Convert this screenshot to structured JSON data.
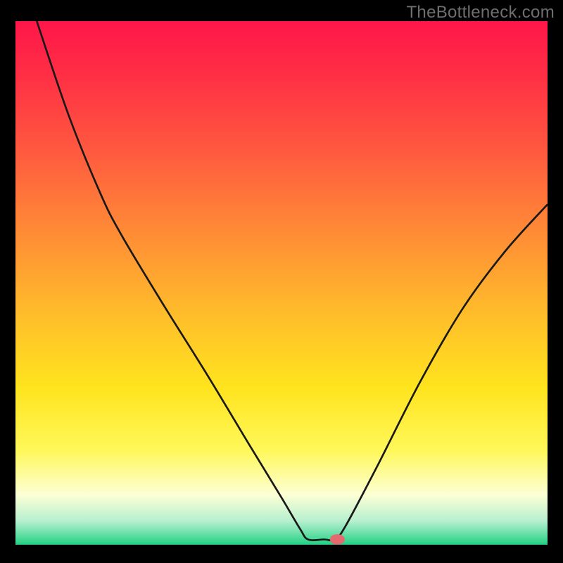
{
  "watermark": "TheBottleneck.com",
  "chart_data": {
    "type": "line",
    "title": "",
    "xlabel": "",
    "ylabel": "",
    "xlim": [
      0,
      100
    ],
    "ylim": [
      0,
      100
    ],
    "background_gradient": {
      "stops": [
        {
          "offset": 0.0,
          "color": "#ff1649"
        },
        {
          "offset": 0.1,
          "color": "#ff2e45"
        },
        {
          "offset": 0.25,
          "color": "#ff5a3f"
        },
        {
          "offset": 0.4,
          "color": "#ff8a36"
        },
        {
          "offset": 0.55,
          "color": "#ffba2b"
        },
        {
          "offset": 0.7,
          "color": "#ffe41e"
        },
        {
          "offset": 0.82,
          "color": "#fff85a"
        },
        {
          "offset": 0.905,
          "color": "#fcffd5"
        },
        {
          "offset": 0.955,
          "color": "#b6f0cf"
        },
        {
          "offset": 1.0,
          "color": "#23d184"
        }
      ]
    },
    "series": [
      {
        "name": "bottleneck-curve",
        "color": "#1a1a1a",
        "stroke_width": 2.7,
        "points": [
          {
            "x": 4.0,
            "y": 100.0
          },
          {
            "x": 10.0,
            "y": 82.0
          },
          {
            "x": 16.0,
            "y": 67.0
          },
          {
            "x": 20.0,
            "y": 59.0
          },
          {
            "x": 28.0,
            "y": 45.5
          },
          {
            "x": 36.0,
            "y": 32.5
          },
          {
            "x": 44.0,
            "y": 19.0
          },
          {
            "x": 50.0,
            "y": 9.0
          },
          {
            "x": 53.5,
            "y": 3.0
          },
          {
            "x": 55.0,
            "y": 1.0
          },
          {
            "x": 58.0,
            "y": 1.0
          },
          {
            "x": 60.0,
            "y": 1.0
          },
          {
            "x": 62.0,
            "y": 3.5
          },
          {
            "x": 68.0,
            "y": 15.0
          },
          {
            "x": 76.0,
            "y": 31.0
          },
          {
            "x": 84.0,
            "y": 45.0
          },
          {
            "x": 92.0,
            "y": 56.0
          },
          {
            "x": 100.0,
            "y": 65.0
          }
        ]
      }
    ],
    "marker": {
      "x": 60.5,
      "y": 1.0,
      "rx": 1.4,
      "ry": 1.0,
      "color": "#e46a6f"
    }
  }
}
